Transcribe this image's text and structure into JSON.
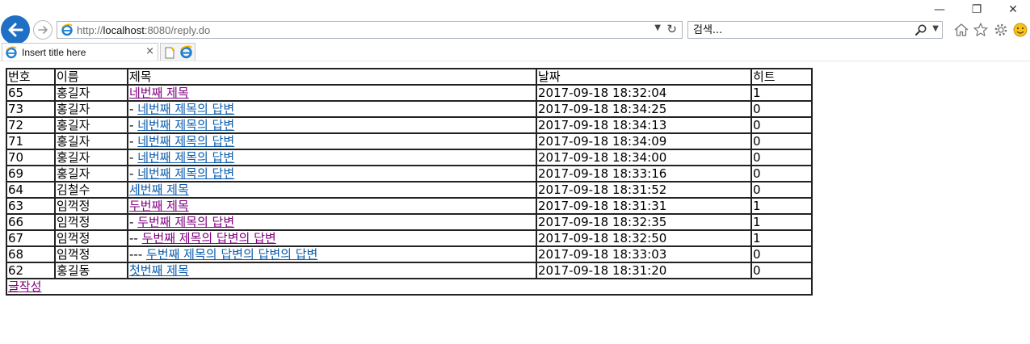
{
  "browser": {
    "window_controls": {
      "minimize": "—",
      "restore": "❐",
      "close": "✕"
    },
    "address": {
      "prefix": "http://",
      "host": "localhost",
      "path": ":8080/reply.do"
    },
    "search": {
      "placeholder": "검색..."
    },
    "tab": {
      "title": "Insert title here",
      "close": "×"
    }
  },
  "board": {
    "headers": {
      "no": "번호",
      "name": "이름",
      "title": "제목",
      "date": "날짜",
      "hits": "히트"
    },
    "rows": [
      {
        "no": "65",
        "name": "홍길자",
        "prefix": "",
        "title": "네번째 제목",
        "visited": true,
        "date": "2017-09-18 18:32:04",
        "hits": "1"
      },
      {
        "no": "73",
        "name": "홍길자",
        "prefix": "- ",
        "title": "네번째 제목의 답변",
        "visited": false,
        "date": "2017-09-18 18:34:25",
        "hits": "0"
      },
      {
        "no": "72",
        "name": "홍길자",
        "prefix": "- ",
        "title": "네번째 제목의 답변",
        "visited": false,
        "date": "2017-09-18 18:34:13",
        "hits": "0"
      },
      {
        "no": "71",
        "name": "홍길자",
        "prefix": "- ",
        "title": "네번째 제목의 답변",
        "visited": false,
        "date": "2017-09-18 18:34:09",
        "hits": "0"
      },
      {
        "no": "70",
        "name": "홍길자",
        "prefix": "- ",
        "title": "네번째 제목의 답변",
        "visited": false,
        "date": "2017-09-18 18:34:00",
        "hits": "0"
      },
      {
        "no": "69",
        "name": "홍길자",
        "prefix": "- ",
        "title": "네번째 제목의 답변",
        "visited": false,
        "date": "2017-09-18 18:33:16",
        "hits": "0"
      },
      {
        "no": "64",
        "name": "김철수",
        "prefix": "",
        "title": "세번째 제목",
        "visited": false,
        "date": "2017-09-18 18:31:52",
        "hits": "0"
      },
      {
        "no": "63",
        "name": "임꺽정",
        "prefix": "",
        "title": "두번째 제목",
        "visited": true,
        "date": "2017-09-18 18:31:31",
        "hits": "1"
      },
      {
        "no": "66",
        "name": "임꺽정",
        "prefix": "- ",
        "title": "두번째 제목의 답변",
        "visited": true,
        "date": "2017-09-18 18:32:35",
        "hits": "1"
      },
      {
        "no": "67",
        "name": "임꺽정",
        "prefix": "-- ",
        "title": "두번째 제목의 답변의 답변",
        "visited": true,
        "date": "2017-09-18 18:32:50",
        "hits": "1"
      },
      {
        "no": "68",
        "name": "임꺽정",
        "prefix": "--- ",
        "title": "두번째 제목의 답변의 답변의 답변",
        "visited": false,
        "date": "2017-09-18 18:33:03",
        "hits": "0"
      },
      {
        "no": "62",
        "name": "홍길동",
        "prefix": "",
        "title": "첫번째 제목",
        "visited": false,
        "date": "2017-09-18 18:31:20",
        "hits": "0"
      }
    ],
    "write_link": "글작성"
  }
}
